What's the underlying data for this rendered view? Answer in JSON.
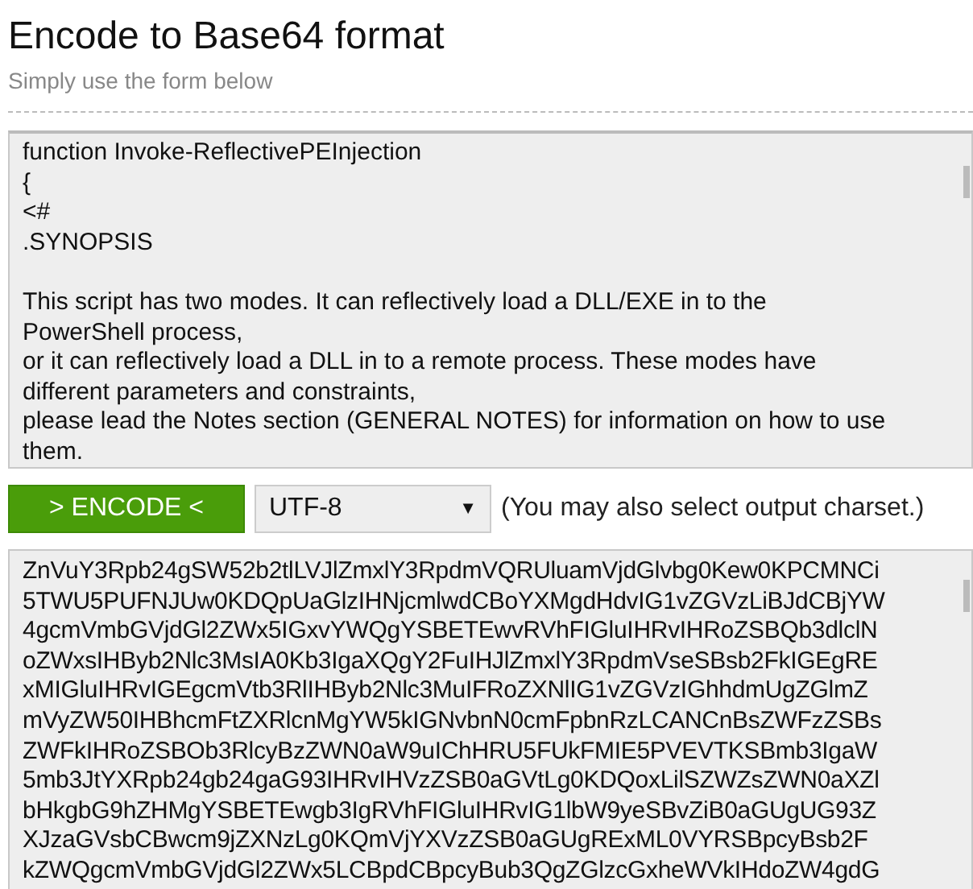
{
  "header": {
    "title": "Encode to Base64 format",
    "subtitle": "Simply use the form below"
  },
  "input": {
    "paragraphs": [
      [
        "function Invoke-ReflectivePEInjection",
        "{",
        "<#",
        ".SYNOPSIS"
      ],
      [
        "This script has two modes. It can reflectively load a DLL/EXE in to the",
        "PowerShell process,",
        "or it can reflectively load a DLL in to a remote process. These modes have",
        "different parameters and constraints,",
        "please lead the Notes section (GENERAL NOTES) for information on how to use",
        "them."
      ]
    ]
  },
  "controls": {
    "button": "> ENCODE <",
    "charset": "UTF-8",
    "dropdown_arrow": "▼",
    "hint": "(You may also select output charset.)"
  },
  "output": {
    "lines": [
      "ZnVuY3Rpb24gSW52b2tlLVJlZmxlY3RpdmVQRUluamVjdGlvbg0Kew0KPCMNCi",
      "5TWU5PUFNJUw0KDQpUaGlzIHNjcmlwdCBoYXMgdHdvIG1vZGVzLiBJdCBjYW",
      "4gcmVmbGVjdGl2ZWx5IGxvYWQgYSBETEwvRVhFIGluIHRvIHRoZSBQb3dlclN",
      "oZWxsIHByb2Nlc3MsIA0Kb3IgaXQgY2FuIHJlZmxlY3RpdmVseSBsb2FkIGEgRE",
      "xMIGluIHRvIGEgcmVtb3RlIHByb2Nlc3MuIFRoZXNlIG1vZGVzIGhhdmUgZGlmZ",
      "mVyZW50IHBhcmFtZXRlcnMgYW5kIGNvbnN0cmFpbnRzLCANCnBsZWFzZSBs",
      "ZWFkIHRoZSBOb3RlcyBzZWN0aW9uIChHRU5FUkFMIE5PVEVTKSBmb3IgaW",
      "5mb3JtYXRpb24gb24gaG93IHRvIHVzZSB0aGVtLg0KDQoxLilSZWZsZWN0aXZl",
      "bHkgbG9hZHMgYSBETEwgb3IgRVhFIGluIHRvIG1lbW9yeSBvZiB0aGUgUG93Z",
      "XJzaGVsbCBwcm9jZXNzLg0KQmVjYXVzZSB0aGUgRExML0VYRSBpcyBsb2F",
      "kZWQgcmVmbGVjdGl2ZWx5LCBpdCBpcyBub3QgZGlzcGxheWVkIHdoZW4gdG"
    ]
  }
}
